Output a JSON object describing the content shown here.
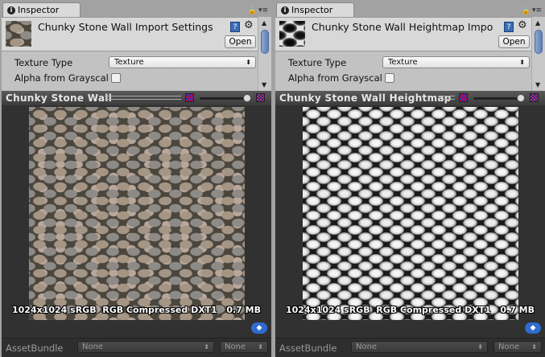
{
  "panels": [
    {
      "tab": "Inspector",
      "title": "Chunky Stone Wall Import Settings",
      "open": "Open",
      "texture_type_label": "Texture Type",
      "texture_type_value": "Texture",
      "alpha_label": "Alpha from Grayscal",
      "alpha_checked": false,
      "preview_name": "Chunky Stone Wall",
      "texture_info": "1024x1024 sRGB  RGB Compressed DXT1   0.7 MB",
      "assetbundle_label": "AssetBundle",
      "assetbundle_value": "None",
      "variant_value": "None"
    },
    {
      "tab": "Inspector",
      "title": "Chunky Stone Wall Heightmap Impor",
      "open": "Open",
      "texture_type_label": "Texture Type",
      "texture_type_value": "Texture",
      "alpha_label": "Alpha from Grayscal",
      "alpha_checked": false,
      "preview_name": "Chunky Stone Wall Heightmap",
      "texture_info": "1024x1024 sRGB  RGB Compressed DXT1   0.7 MB",
      "assetbundle_label": "AssetBundle",
      "assetbundle_value": "None",
      "variant_value": "None"
    }
  ],
  "colors": {
    "accent": "#2f6bd0",
    "preview_bg": "#313131"
  }
}
